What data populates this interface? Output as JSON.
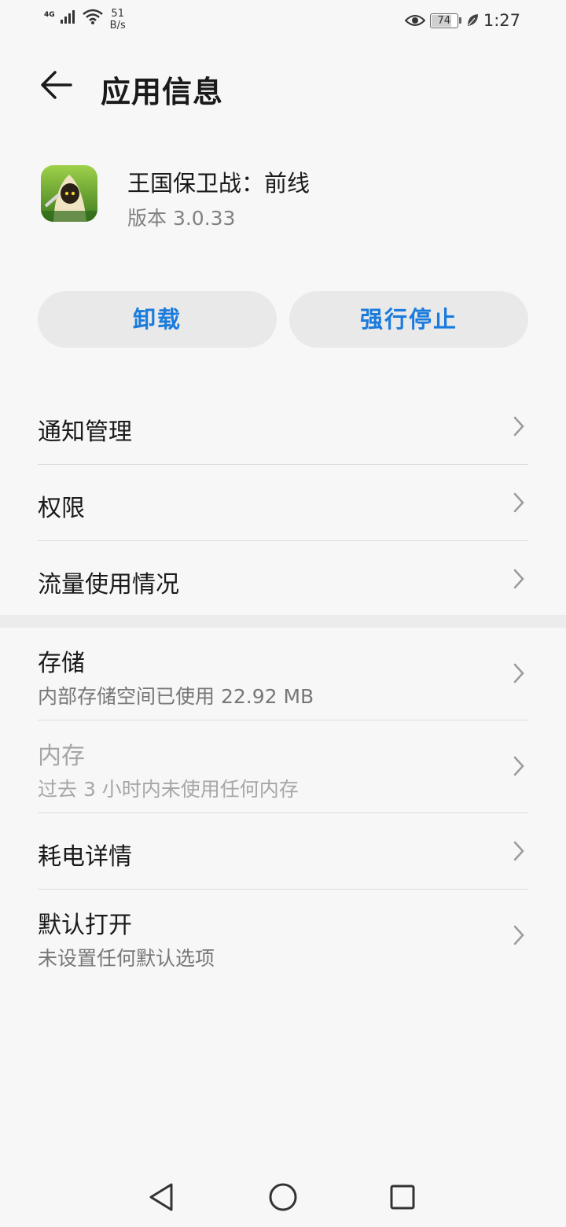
{
  "status_bar": {
    "network": "4G",
    "speed_value": "51",
    "speed_unit": "B/s",
    "battery_level": "74",
    "time": "1:27"
  },
  "header": {
    "title": "应用信息",
    "back_icon": "arrow-left-icon"
  },
  "app": {
    "name": "王国保卫战：前线",
    "version": "版本 3.0.33"
  },
  "actions": {
    "uninstall_label": "卸载",
    "force_stop_label": "强行停止"
  },
  "menu_group_1": [
    {
      "label": "通知管理"
    },
    {
      "label": "权限"
    },
    {
      "label": "流量使用情况"
    }
  ],
  "menu_group_2": [
    {
      "label": "存储",
      "sub": "内部存储空间已使用 22.92 MB"
    },
    {
      "label": "内存",
      "sub": "过去 3 小时内未使用任何内存",
      "disabled": true
    },
    {
      "label": "耗电详情"
    },
    {
      "label": "默认打开",
      "sub": "未设置任何默认选项"
    }
  ],
  "colors": {
    "accent": "#1a7bdc",
    "background": "#f7f7f7",
    "button_bg": "#e9e9e9"
  }
}
